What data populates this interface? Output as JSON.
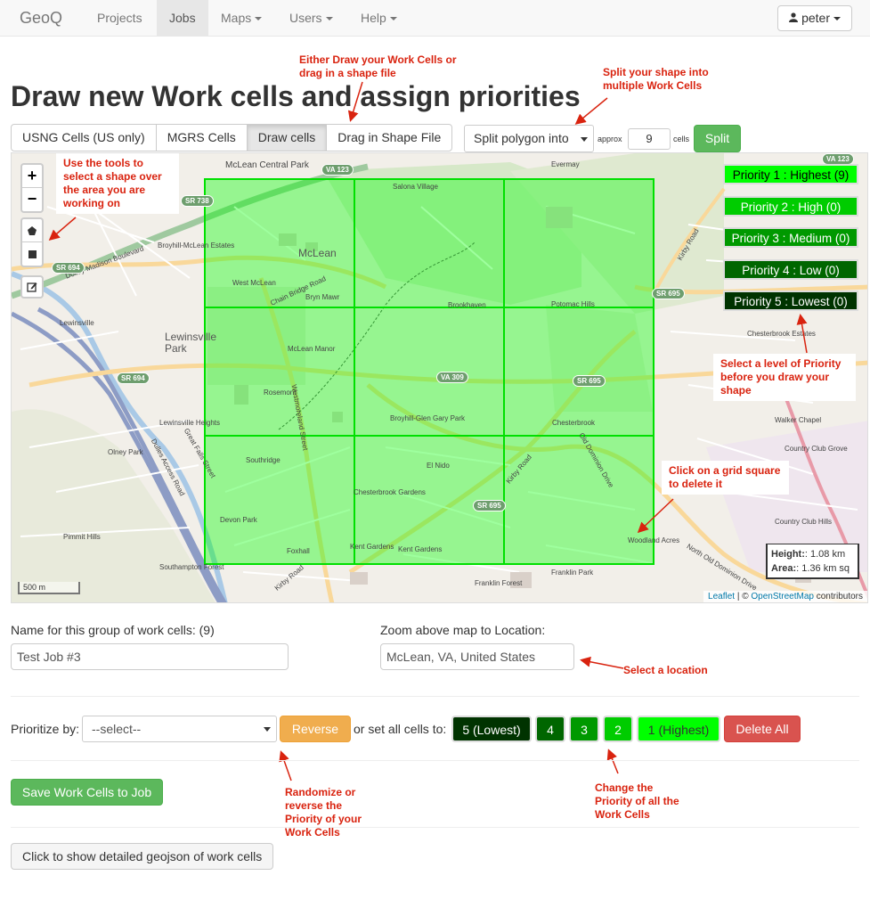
{
  "navbar": {
    "brand": "GeoQ",
    "items": [
      {
        "label": "Projects"
      },
      {
        "label": "Jobs"
      },
      {
        "label": "Maps"
      },
      {
        "label": "Users"
      },
      {
        "label": "Help"
      }
    ],
    "user": "peter"
  },
  "page_title": "Draw new Work cells and assign priorities",
  "cell_tools": [
    "USNG Cells (US only)",
    "MGRS Cells",
    "Draw cells",
    "Drag in Shape File"
  ],
  "split": {
    "select_value": "Split polygon into",
    "approx_label": "approx",
    "cells_value": "9",
    "cells_label": "cells",
    "button": "Split"
  },
  "priority_buttons": [
    {
      "label": "Priority 1 : Highest (9)",
      "color": "#00ff00"
    },
    {
      "label": "Priority 2 : High (0)",
      "color": "#00cc00"
    },
    {
      "label": "Priority 3 : Medium (0)",
      "color": "#009900"
    },
    {
      "label": "Priority 4 : Low (0)",
      "color": "#006600"
    },
    {
      "label": "Priority 5 : Lowest (0)",
      "color": "#003300"
    }
  ],
  "map": {
    "zoom_in": "+",
    "zoom_out": "−",
    "scale": "500 m",
    "height_label": "Height:",
    "height_value": ": 1.08 km",
    "area_label": "Area:",
    "area_value": ": 1.36 km sq",
    "attribution_leaflet": "Leaflet",
    "attribution_sep": " | © ",
    "attribution_osm": "OpenStreetMap",
    "attribution_tail": " contributors",
    "labels": [
      "McLean Central Park",
      "Salona Village",
      "Evermay",
      "McLean",
      "Broyhill-McLean Estates",
      "West McLean",
      "Bryn Mawr",
      "Chain Bridge Road",
      "Brookhaven",
      "Potomac Hills",
      "Lewinsville",
      "Lewinsville Park",
      "McLean Manor",
      "Chesterbrook Estates",
      "Rosemont",
      "Broyhill-Glen Gary Park",
      "Lewinsville Heights",
      "Chesterbrook",
      "Walker Chapel",
      "Olney Park",
      "Country Club Grove",
      "Southridge",
      "El Nido",
      "Chesterbrook Gardens",
      "Devon Park",
      "Country Club Hills",
      "Pimmit Hills",
      "Foxhall",
      "Kent Gardens",
      "Woodland Acres",
      "Southampton Forest",
      "Franklin Forest",
      "Franklin Park",
      "Dolley Madison Boulevard",
      "Westmoreland Street",
      "Great Falls Street",
      "Dulles Access Road",
      "Kirby Road",
      "Old Dominion Drive",
      "North Old Dominion Drive",
      "Kirby Road",
      "Kirby Road",
      "Kent Gardens"
    ],
    "shields": [
      "VA 123",
      "SR 738",
      "SR 694",
      "SR 694",
      "SR 695",
      "VA 309",
      "SR 695",
      "SR 695",
      "VA 123"
    ]
  },
  "annotations": {
    "draw_or_drag": "Either Draw your Work Cells or drag in a shape file",
    "split": "Split your shape into multiple Work Cells",
    "tools": "Use the tools to select a shape over the area you are working on",
    "priority": "Select a level of Priority before you draw your shape",
    "delete": "Click on a grid square to delete it",
    "location": "Select a location",
    "randomize": "Randomize or reverse the Priority of your Work Cells",
    "change_all": "Change the Priority of all the Work Cells"
  },
  "form": {
    "name_label": "Name for this group of work cells: (9)",
    "name_value": "Test Job #3",
    "zoom_label": "Zoom above map to Location:",
    "zoom_value": "McLean, VA, United States",
    "prioritize_label": "Prioritize by:",
    "prioritize_value": "--select--",
    "reverse": "Reverse",
    "set_all_label": "or set all cells to:",
    "set_buttons": [
      "5 (Lowest)",
      "4",
      "3",
      "2",
      "1 (Highest)"
    ],
    "delete_all": "Delete All",
    "save": "Save Work Cells to Job",
    "geojson": "Click to show detailed geojson of work cells"
  }
}
